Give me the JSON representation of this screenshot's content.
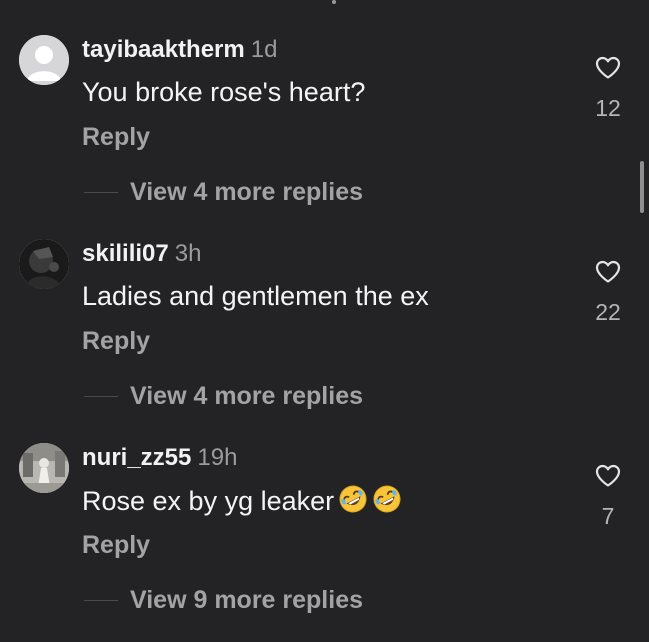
{
  "comments": [
    {
      "username": "tayibaaktherm",
      "time": "1d",
      "text": "You broke rose's heart?",
      "reply_label": "Reply",
      "view_replies": "View 4 more replies",
      "likes": "12",
      "avatar": "default-user-icon"
    },
    {
      "username": "skilili07",
      "time": "3h",
      "text": "Ladies and gentlemen the ex",
      "reply_label": "Reply",
      "view_replies": "View 4 more replies",
      "likes": "22",
      "avatar": "photo-avatar"
    },
    {
      "username": "nuri_zz55",
      "time": "19h",
      "text": "Rose ex by yg leaker",
      "emojis": [
        "rolling-on-floor-laughing",
        "rolling-on-floor-laughing"
      ],
      "reply_label": "Reply",
      "view_replies": "View 9 more replies",
      "likes": "7",
      "avatar": "photo-avatar"
    }
  ],
  "colors": {
    "background": "#232325",
    "primary_text": "#f2f2f2",
    "secondary_text": "#a3a3a5"
  }
}
